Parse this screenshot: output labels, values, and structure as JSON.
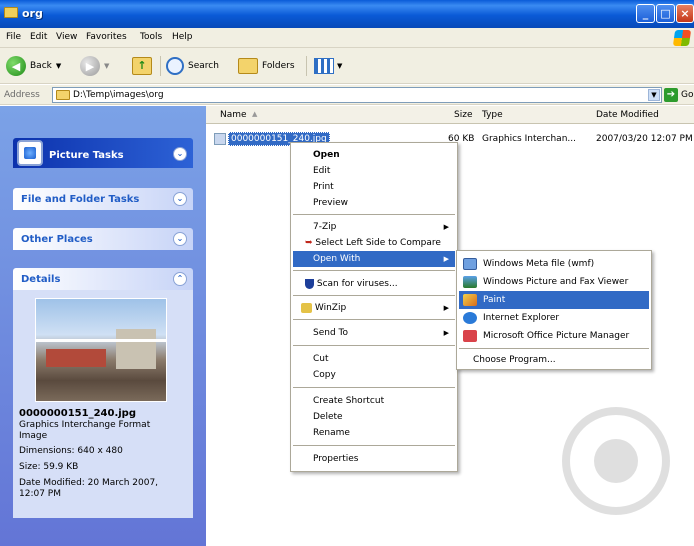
{
  "window": {
    "title": "org"
  },
  "menubar": [
    "File",
    "Edit",
    "View",
    "Favorites",
    "Tools",
    "Help"
  ],
  "toolbar": {
    "back": "Back",
    "search": "Search",
    "folders": "Folders"
  },
  "address": {
    "label": "Address",
    "path": "D:\\Temp\\images\\org",
    "go": "Go"
  },
  "tasks": {
    "picture_tasks": "Picture Tasks",
    "file_folder_tasks": "File and Folder Tasks",
    "other_places": "Other Places",
    "details": "Details"
  },
  "details": {
    "filename": "0000000151_240.jpg",
    "type_line1": "Graphics Interchange Format",
    "type_line2": "Image",
    "dimensions": "Dimensions: 640 x 480",
    "size": "Size: 59.9 KB",
    "modified_line1": "Date Modified: 20 March 2007,",
    "modified_line2": "12:07 PM"
  },
  "columns": {
    "name": "Name",
    "size": "Size",
    "type": "Type",
    "date": "Date Modified"
  },
  "file": {
    "name": "0000000151_240.jpg",
    "size": "60 KB",
    "type": "Graphics Interchan...",
    "date": "2007/03/20 12:07 PM"
  },
  "context_menu": {
    "open": "Open",
    "edit": "Edit",
    "print": "Print",
    "preview": "Preview",
    "zip": "7-Zip",
    "compare": "Select Left Side to Compare",
    "open_with": "Open With",
    "scan": "Scan for viruses...",
    "winzip": "WinZip",
    "send_to": "Send To",
    "cut": "Cut",
    "copy": "Copy",
    "create_shortcut": "Create Shortcut",
    "delete": "Delete",
    "rename": "Rename",
    "properties": "Properties"
  },
  "open_with": {
    "wmf": "Windows Meta file (wmf)",
    "viewer": "Windows Picture and Fax Viewer",
    "paint": "Paint",
    "ie": "Internet Explorer",
    "office": "Microsoft Office Picture Manager",
    "choose": "Choose Program..."
  }
}
